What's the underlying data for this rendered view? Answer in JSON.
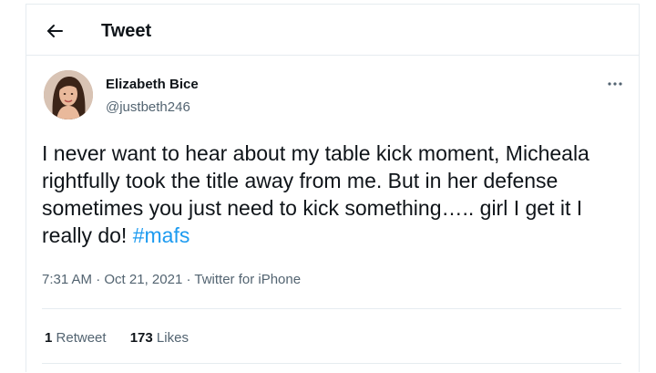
{
  "header": {
    "title": "Tweet",
    "back_icon": "arrow-left-icon"
  },
  "tweet": {
    "author": {
      "name": "Elizabeth Bice",
      "handle": "@justbeth246"
    },
    "text": "I never want to hear about my table kick moment, Micheala rightfully took the title away from me. But in her defense sometimes you just need to kick something….. girl I get it I really do! ",
    "hashtag": "#mafs",
    "time": "7:31 AM",
    "date": "Oct 21, 2021",
    "source": "Twitter for iPhone",
    "separator": " · ",
    "more_icon": "more-horizontal-icon"
  },
  "stats": {
    "retweets_count": "1",
    "retweets_label": "Retweet",
    "likes_count": "173",
    "likes_label": "Likes"
  },
  "colors": {
    "accent": "#1d9bf0",
    "text_primary": "#0f1419",
    "text_secondary": "#536471",
    "border": "#e6ecf0"
  }
}
